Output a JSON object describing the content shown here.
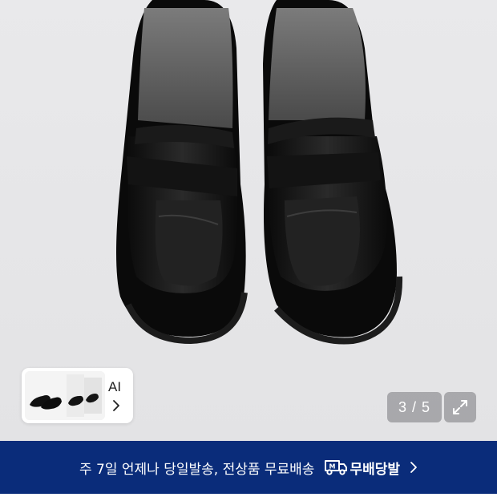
{
  "gallery": {
    "image_subject": "black leather penny loafers",
    "thumbnail": {
      "ai_label": "AI",
      "chevron_icon": "chevron-right-icon"
    },
    "counter": {
      "current": "3",
      "separator": " / ",
      "total": "5",
      "text": "3 / 5"
    },
    "expand_icon": "expand-arrows-icon"
  },
  "banner": {
    "text": "주 7일 언제나 당일발송, 전상품 무료배송",
    "brand_icon": "truck-icon",
    "brand_label": "무배당발",
    "chevron_icon": "chevron-right-icon"
  },
  "colors": {
    "banner_bg": "#0a2c7a",
    "viewer_bg": "#e6e6e8",
    "counter_bg": "#7a7a7e"
  }
}
